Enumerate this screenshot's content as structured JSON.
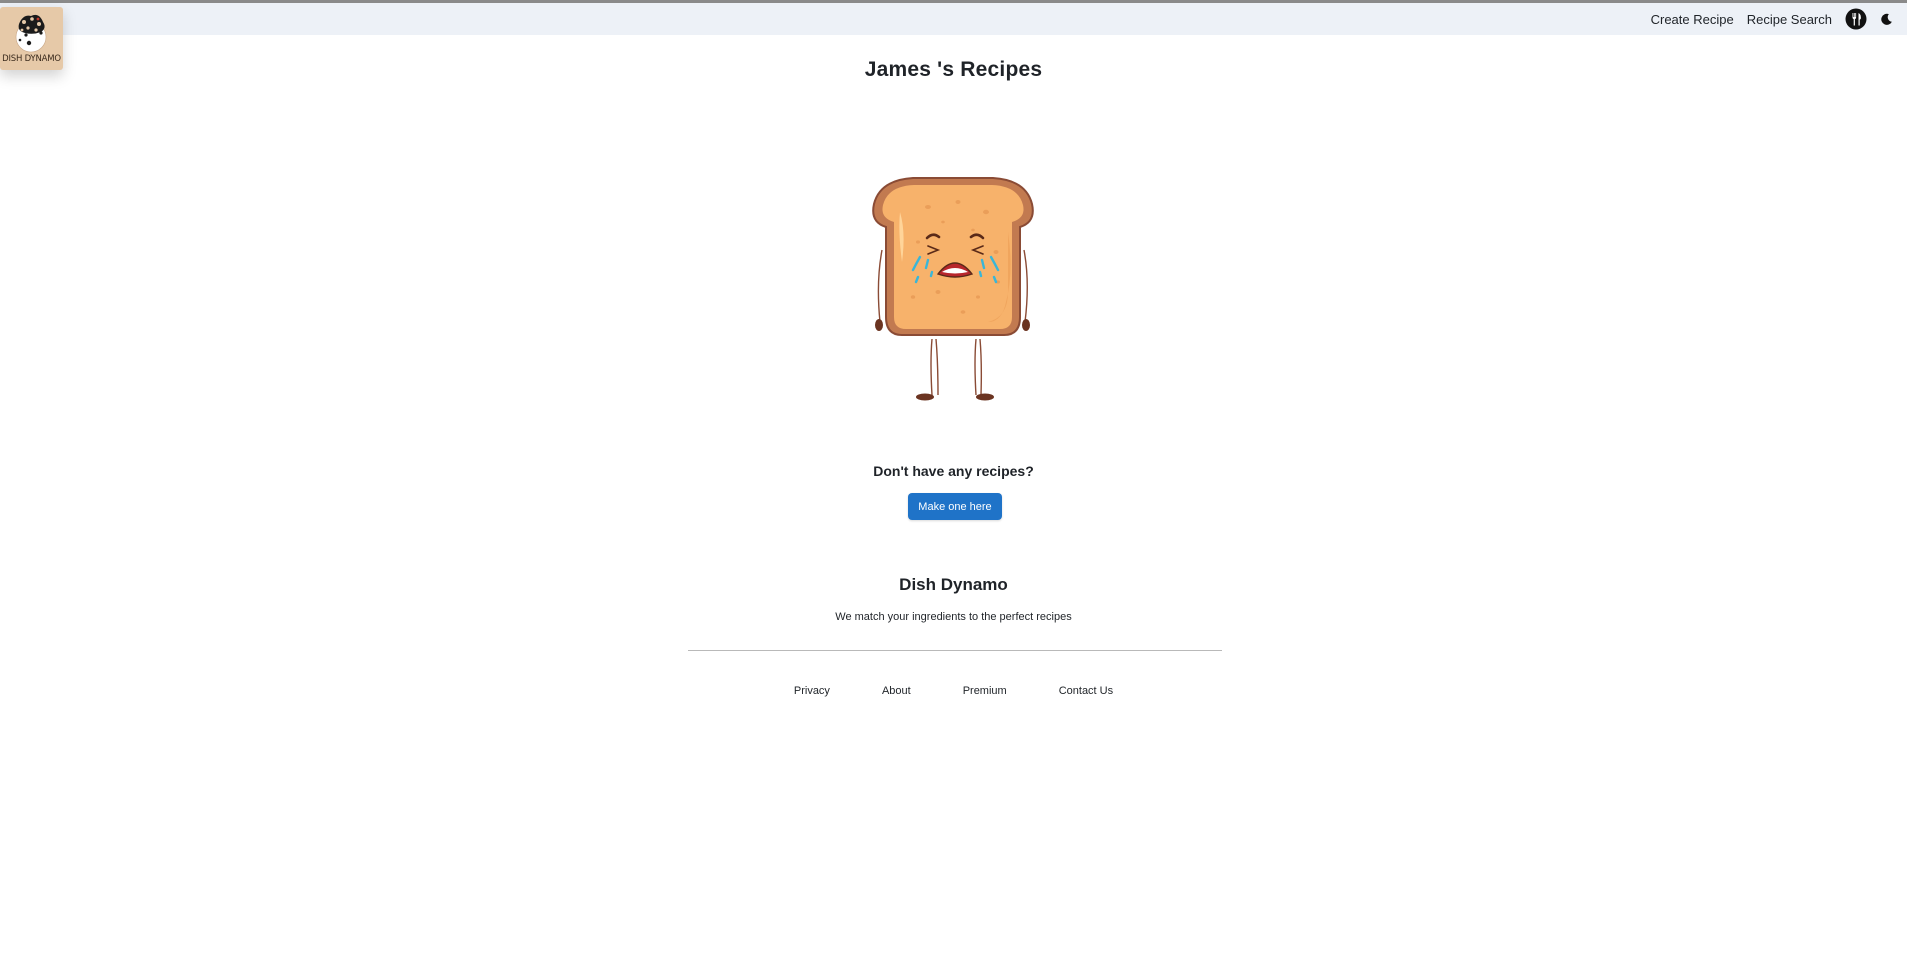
{
  "brand": {
    "logo_text": "DISH DYNAMO"
  },
  "nav": {
    "links": [
      "Create Recipe",
      "Recipe Search"
    ],
    "utensils_icon": "fork-knife-icon",
    "theme_icon": "moon-icon"
  },
  "main": {
    "title": "James 's Recipes",
    "illustration": "crying-toast",
    "empty_heading": "Don't have any recipes?",
    "cta_label": "Make one here"
  },
  "footer": {
    "brand": "Dish Dynamo",
    "tagline": "We match your ingredients to the perfect recipes",
    "links": [
      "Privacy",
      "About",
      "Premium",
      "Contact Us"
    ]
  },
  "colors": {
    "nav_bg": "#edf1f7",
    "cta_bg": "#1f73c8",
    "logo_bg": "#e6c9a8"
  }
}
